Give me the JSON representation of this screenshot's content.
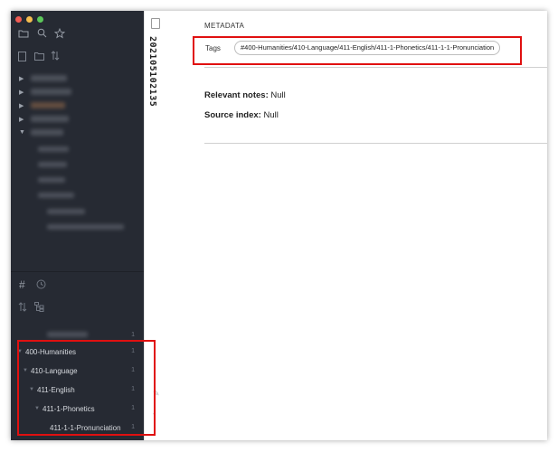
{
  "file_title": "20210510213‍5",
  "metadata": {
    "heading": "METADATA",
    "tags_label": "Tags",
    "tag_value": "#400-Humanities/410-Language/411-English/411-1-Phonetics/411-1-1-Pronunciation"
  },
  "properties": [
    {
      "key": "Relevant notes",
      "sep": ": ",
      "value": "Null"
    },
    {
      "key": "Source index",
      "sep": ": ",
      "value": "Null"
    }
  ],
  "tag_tree": [
    {
      "label": "400-Humanities",
      "count": "1"
    },
    {
      "label": "410-Language",
      "count": "1"
    },
    {
      "label": "411-English",
      "count": "1"
    },
    {
      "label": "411-1-Phonetics",
      "count": "1"
    },
    {
      "label": "411-1-1-Pronunciation",
      "count": "1"
    }
  ],
  "hidden_tag_count": "1",
  "icons": {
    "toolbar": [
      "folder-icon",
      "search-icon",
      "star-icon"
    ],
    "file_actions": [
      "new-note-icon",
      "new-folder-icon",
      "sort-icon"
    ],
    "tag_actions": [
      "hash-icon",
      "clock-icon"
    ],
    "tag_sort": [
      "sort-icon",
      "tree-icon"
    ],
    "edge": [
      "pencil-icon",
      "collapse-icon"
    ]
  },
  "colors": {
    "sidebar_bg": "#262a33",
    "highlight": "#e01010",
    "traffic_red": "#f25c54",
    "traffic_yellow": "#f6be4f",
    "traffic_green": "#5cc85a"
  }
}
